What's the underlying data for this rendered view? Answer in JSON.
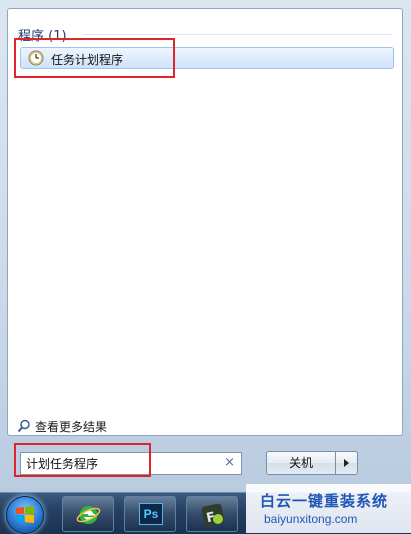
{
  "start_menu": {
    "section_title": "程序 (1)",
    "results": [
      {
        "label": "任务计划程序",
        "icon": "clock-icon"
      }
    ],
    "see_more": "查看更多结果",
    "search": {
      "value": "计划任务程序",
      "clear_icon": "×"
    },
    "shutdown": {
      "label": "关机"
    }
  },
  "taskbar": {
    "ps_label": "Ps"
  },
  "watermark": {
    "title": "白云一键重装系统",
    "url": "baiyunxitong.com"
  },
  "colors": {
    "highlight": "#e0242b",
    "section_title": "#1e3c6e",
    "selected_item_bg": "#dbeafb"
  }
}
